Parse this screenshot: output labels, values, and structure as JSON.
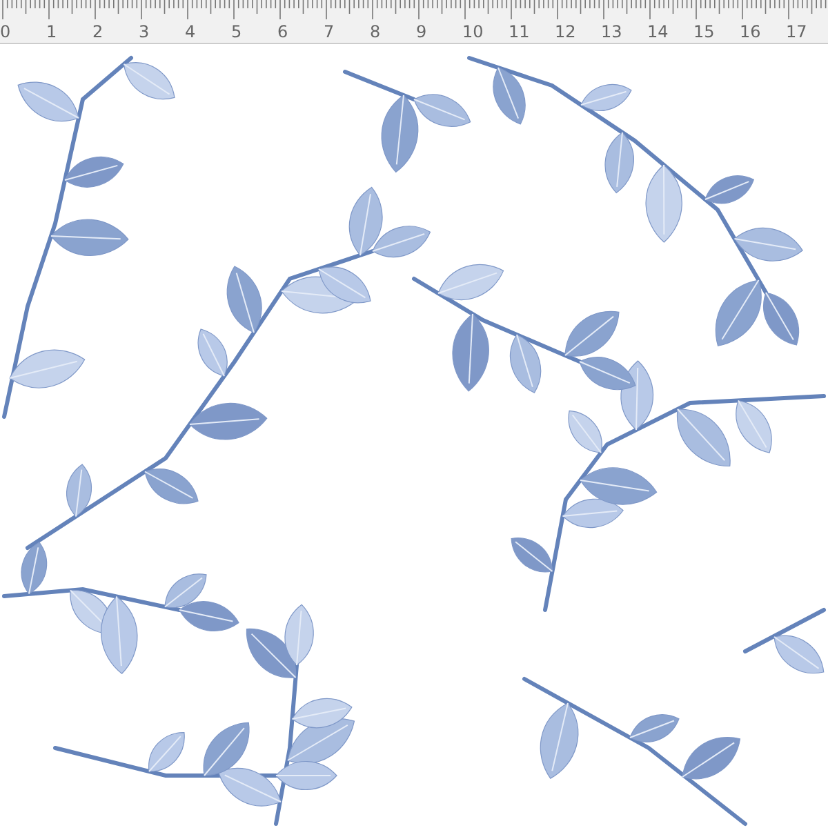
{
  "ruler": {
    "labels": [
      "0",
      "1",
      "2",
      "3",
      "4",
      "5",
      "6",
      "7",
      "8",
      "9",
      "10",
      "11",
      "12",
      "13",
      "14",
      "15",
      "16",
      "17"
    ]
  }
}
